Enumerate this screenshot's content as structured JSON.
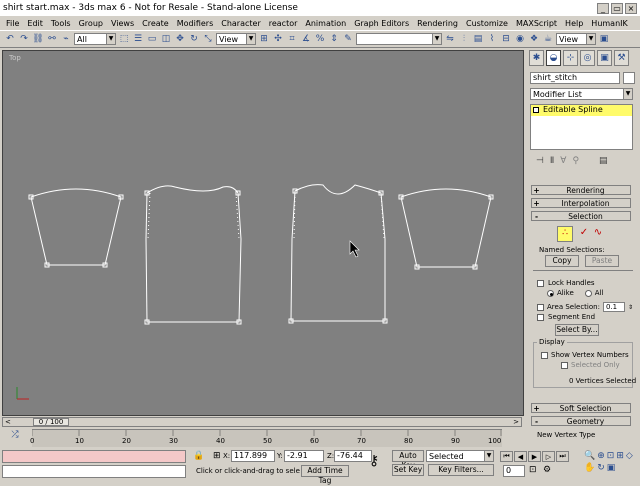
{
  "window": {
    "title": "shirt start.max - 3ds max 6 - Not for Resale - Stand-alone License",
    "buttons": [
      "_",
      "▭",
      "×"
    ]
  },
  "menu": [
    "File",
    "Edit",
    "Tools",
    "Group",
    "Views",
    "Create",
    "Modifiers",
    "Character",
    "reactor",
    "Animation",
    "Graph Editors",
    "Rendering",
    "Customize",
    "MAXScript",
    "Help",
    "HumanIK"
  ],
  "toolbar": {
    "selection_filter": "All",
    "ref_coord": "View",
    "named_sel": "",
    "render_type": "View"
  },
  "viewport": {
    "label": "Top",
    "bg": "#808080",
    "axis_label": "x"
  },
  "command_panel": {
    "tab_icons": [
      "create-icon",
      "modify-icon",
      "hierarchy-icon",
      "motion-icon",
      "display-icon",
      "utilities-icon"
    ],
    "object_name": "shirt_stitch",
    "modifier_list": "Modifier List",
    "stack_item": "Editable Spline",
    "rollouts": {
      "rendering": "Rendering",
      "interpolation": "Interpolation",
      "selection": "Selection",
      "soft_selection": "Soft Selection",
      "geometry": "Geometry"
    },
    "named_selections_label": "Named Selections:",
    "copy": "Copy",
    "paste": "Paste",
    "lock_handles": "Lock Handles",
    "alike": "Alike",
    "all": "All",
    "area_selection": "Area Selection:",
    "area_value": "0.1",
    "segment_end": "Segment End",
    "select_by": "Select By...",
    "display_label": "Display",
    "show_vertex_numbers": "Show Vertex Numbers",
    "selected_only": "Selected Only",
    "vertices_selected": "0 Vertices Selected",
    "new_vertex_type": "New Vertex Type"
  },
  "timeline": {
    "slider": "0 / 100",
    "ticks": [
      "0",
      "10",
      "20",
      "30",
      "40",
      "50",
      "60",
      "70",
      "80",
      "90",
      "100"
    ]
  },
  "status": {
    "x_label": "X:",
    "x_value": "117.899",
    "y_label": "Y:",
    "y_value": "-2.91",
    "z_label": "Z:",
    "z_value": "-76.44",
    "prompt": "Click or click-and-drag to select ob",
    "add_time_tag": "Add Time Tag",
    "auto_key": "Auto Key",
    "set_key": "Set Key",
    "key_mode": "Selected",
    "key_filters": "Key Filters...",
    "frame": "0"
  },
  "colors": {
    "ui_bg": "#d4d0c8",
    "stack_highlight": "#fffb6a",
    "spline": "#ffffff",
    "status_pink": "#f4c8c8"
  }
}
